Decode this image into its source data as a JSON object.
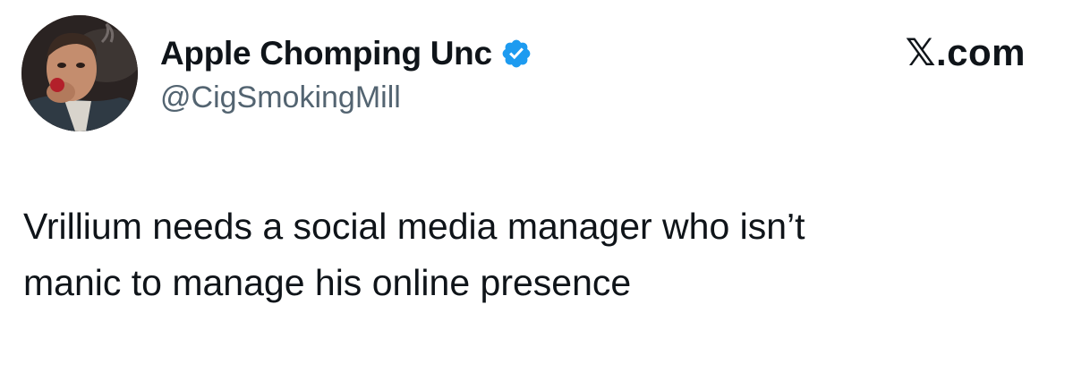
{
  "author": {
    "display_name": "Apple Chomping Unc",
    "handle": "@CigSmokingMill",
    "verified": true,
    "avatar_icon": "profile-photo"
  },
  "brand": {
    "label": "𝕏.com"
  },
  "tweet": {
    "lines": [
      "Vrillium needs a social media manager who isn’t",
      "manic to manage his online presence"
    ]
  },
  "colors": {
    "text": "#0f1419",
    "secondary_text": "#536471",
    "verified": "#1d9bf0",
    "background": "#ffffff"
  }
}
